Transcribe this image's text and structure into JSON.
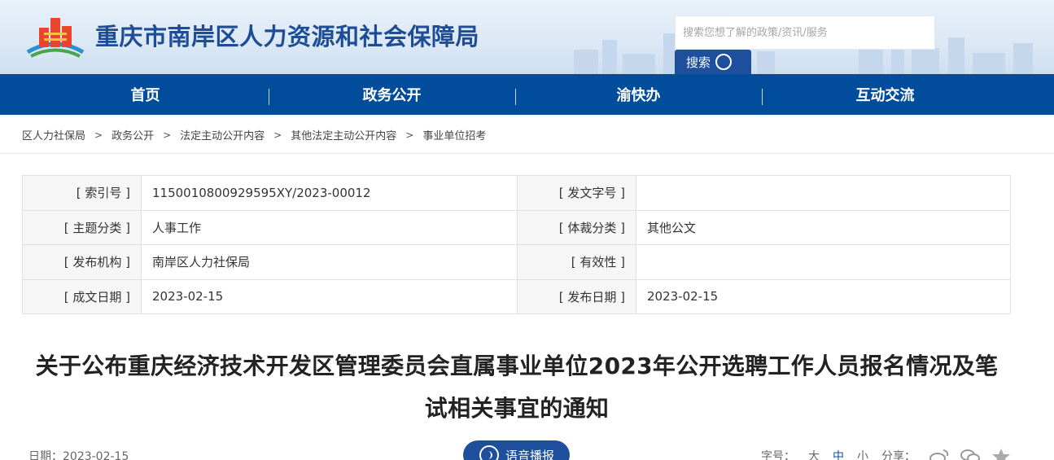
{
  "header": {
    "site_title": "重庆市南岸区人力资源和社会保障局",
    "search_placeholder": "搜索您想了解的政策/资讯/服务",
    "search_button": "搜索"
  },
  "nav": {
    "items": [
      "首页",
      "政务公开",
      "渝快办",
      "互动交流"
    ]
  },
  "breadcrumb": {
    "items": [
      "区人力社保局",
      "政务公开",
      "法定主动公开内容",
      "其他法定主动公开内容",
      "事业单位招考"
    ],
    "separator": ">"
  },
  "meta": {
    "rows": [
      {
        "label1": "[ 索引号 ]",
        "value1": "11500108009295 95XY/2023-00012",
        "label2": "[ 发文字号 ]",
        "value2": ""
      },
      {
        "label1": "[ 主题分类 ]",
        "value1": "人事工作",
        "label2": "[ 体裁分类 ]",
        "value2": "其他公文"
      },
      {
        "label1": "[ 发布机构 ]",
        "value1": "南岸区人力社保局",
        "label2": "[ 有效性 ]",
        "value2": ""
      },
      {
        "label1": "[ 成文日期 ]",
        "value1": "2023-02-15",
        "label2": "[ 发布日期 ]",
        "value2": "2023-02-15"
      }
    ]
  },
  "article": {
    "title": "关于公布重庆经济技术开发区管理委员会直属事业单位2023年公开选聘工作人员报名情况及笔试相关事宜的通知",
    "date": "日期：2023-02-15",
    "voice_button": "语音播报"
  },
  "toolbar": {
    "font_label": "字号：",
    "font_large": "大",
    "font_medium": "中",
    "font_small": "小",
    "share_label": "分享：",
    "share_icons": [
      "weibo-icon",
      "wechat-icon",
      "favorite-icon"
    ]
  },
  "colors": {
    "nav_bg": "#024d9b",
    "title_blue": "#1d4d96",
    "button_blue": "#1e4f9c"
  }
}
